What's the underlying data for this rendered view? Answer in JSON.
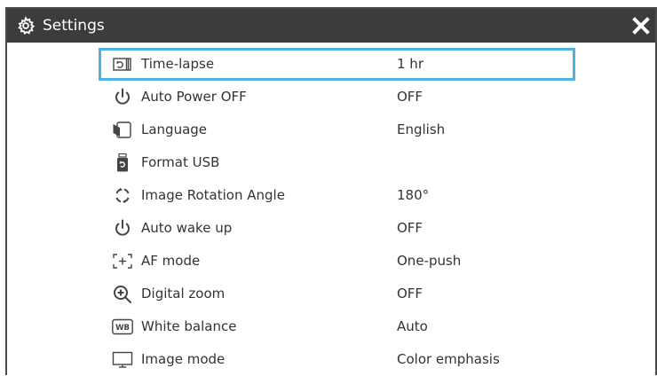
{
  "window": {
    "title": "Settings",
    "title_icon": "gear-icon",
    "close_icon": "close-icon"
  },
  "settings": [
    {
      "label": "Time-lapse",
      "value": "1 hr",
      "icon": "time-lapse-icon",
      "selected": true
    },
    {
      "label": "Auto Power OFF",
      "value": "OFF",
      "icon": "power-icon"
    },
    {
      "label": "Language",
      "value": "English",
      "icon": "language-icon"
    },
    {
      "label": "Format USB",
      "value": "",
      "icon": "usb-format-icon"
    },
    {
      "label": "Image Rotation Angle",
      "value": "180°",
      "icon": "rotation-icon"
    },
    {
      "label": "Auto wake up",
      "value": "OFF",
      "icon": "power-icon"
    },
    {
      "label": "AF mode",
      "value": "One-push",
      "icon": "af-mode-icon"
    },
    {
      "label": "Digital zoom",
      "value": "OFF",
      "icon": "zoom-icon"
    },
    {
      "label": "White balance",
      "value": "Auto",
      "icon": "white-balance-icon"
    },
    {
      "label": "Image mode",
      "value": "Color emphasis",
      "icon": "monitor-icon"
    }
  ],
  "colors": {
    "titlebar": "#3c3c3c",
    "selection_border": "#4fb3e0",
    "text": "#333333"
  },
  "white_balance_icon_text": "WB"
}
